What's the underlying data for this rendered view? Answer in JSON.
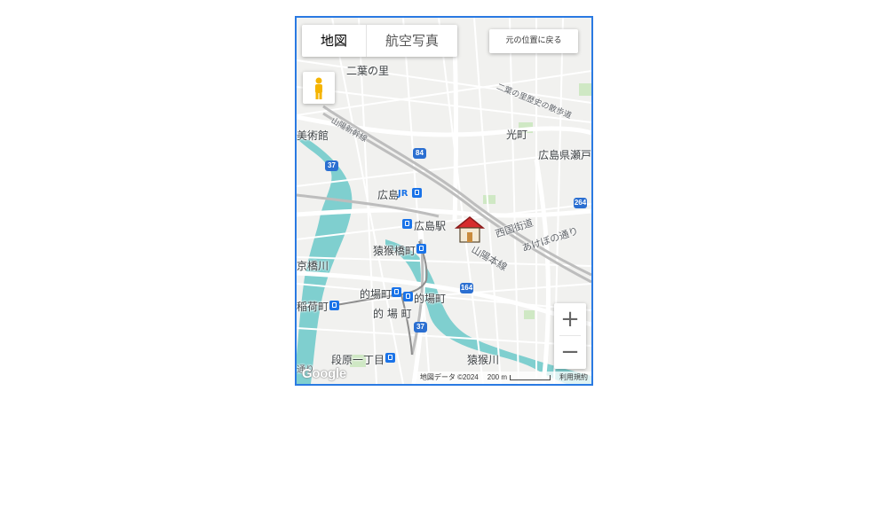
{
  "map": {
    "tabs": [
      {
        "label": "地図",
        "active": true
      },
      {
        "label": "航空写真",
        "active": false
      }
    ],
    "reset_button": "元の位置に戻る",
    "zoom_in": "+",
    "zoom_out": "−",
    "footer": {
      "attribution": "地図データ ©2024",
      "scale": "200 m",
      "terms": "利用規約"
    },
    "logo": "Google",
    "labels": {
      "futaba_no_sato": "二葉の里",
      "futaba_walk": "二葉の里歴史の散歩道",
      "sanyo_shinkansen": "山陽新幹線",
      "bijutsukan": "美術館",
      "hikarimachi": "光町",
      "hiroshima_seto": "広島県瀬戸",
      "hiroshima": "広島",
      "hiroshima_eki": "広島駅",
      "saigoku_kaido": "西国街道",
      "akebono_dori": "あけぼの通り",
      "sanyo_honsen": "山陽本線",
      "enkobashi_cho": "猿猴橋町",
      "kyobashi_gawa": "京橋川",
      "matoba_cho_1": "的場町",
      "matoba_cho_2": "的場町",
      "matoba_cho_3": "的 場 町",
      "inari_machi": "稲荷町",
      "danbara": "段原一丁目",
      "enko_gawa": "猿猴川",
      "dori": "通り"
    },
    "route_shields": [
      "84",
      "37",
      "264",
      "164",
      "37"
    ],
    "colors": {
      "water": "#7fcfcf",
      "park": "#cfe8c4",
      "road": "#ffffff",
      "rail": "#bdbdbd",
      "land": "#f1f1ef",
      "accent": "#2a7ae2"
    }
  }
}
